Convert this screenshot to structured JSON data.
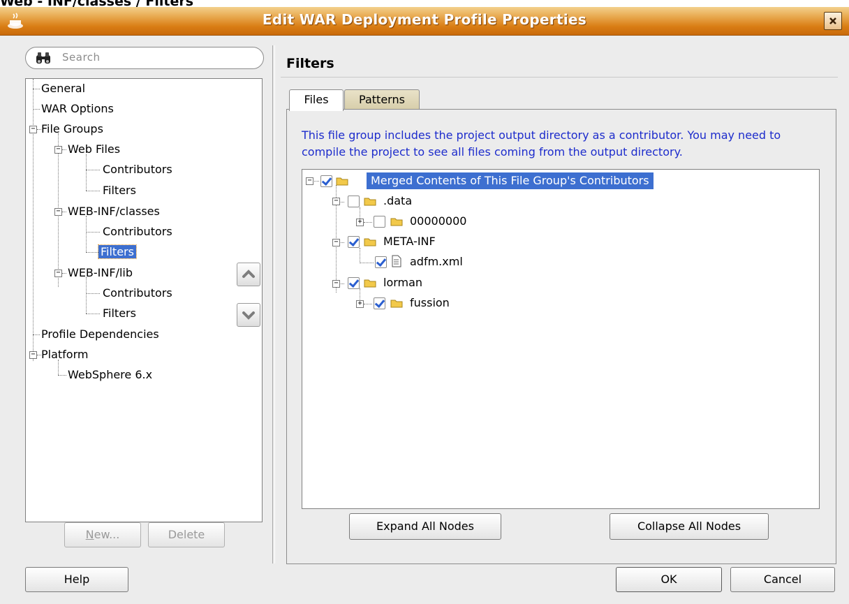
{
  "top_caption": "Web - INF/classes / Filters",
  "window": {
    "title": "Edit WAR Deployment Profile Properties"
  },
  "search": {
    "placeholder": "Search"
  },
  "nav": {
    "general": "General",
    "war_options": "WAR Options",
    "file_groups": "File Groups",
    "web_files": "Web Files",
    "web_files_contributors": "Contributors",
    "web_files_filters": "Filters",
    "webinf_classes": "WEB-INF/classes",
    "webinf_classes_contributors": "Contributors",
    "webinf_classes_filters": "Filters",
    "webinf_lib": "WEB-INF/lib",
    "webinf_lib_contributors": "Contributors",
    "webinf_lib_filters": "Filters",
    "profile_dependencies": "Profile Dependencies",
    "platform": "Platform",
    "websphere": "WebSphere 6.x"
  },
  "left_buttons": {
    "new": "New...",
    "new_mnemonic": "N",
    "delete": "Delete",
    "delete_mnemonic": "t"
  },
  "panel": {
    "title": "Filters",
    "tabs": [
      "Files",
      "Patterns"
    ],
    "info": "This file group includes the project output directory as a contributor.  You may need to compile the project to see all files coming from the output directory."
  },
  "files_tree": {
    "root": "Merged Contents of This File Group's Contributors",
    "data": ".data",
    "zeros": "00000000",
    "meta_inf": "META-INF",
    "adfm": "adfm.xml",
    "lorman": "lorman",
    "fussion": "fussion"
  },
  "panel_buttons": {
    "expand": "Expand All Nodes",
    "collapse": "Collapse All Nodes"
  },
  "footer": {
    "help": "Help",
    "ok": "OK",
    "cancel": "Cancel"
  },
  "colors": {
    "title_bar": "#d97d14",
    "selection": "#3d6fd0",
    "info_text": "#1d2ccc",
    "check": "#2b5fd0"
  }
}
